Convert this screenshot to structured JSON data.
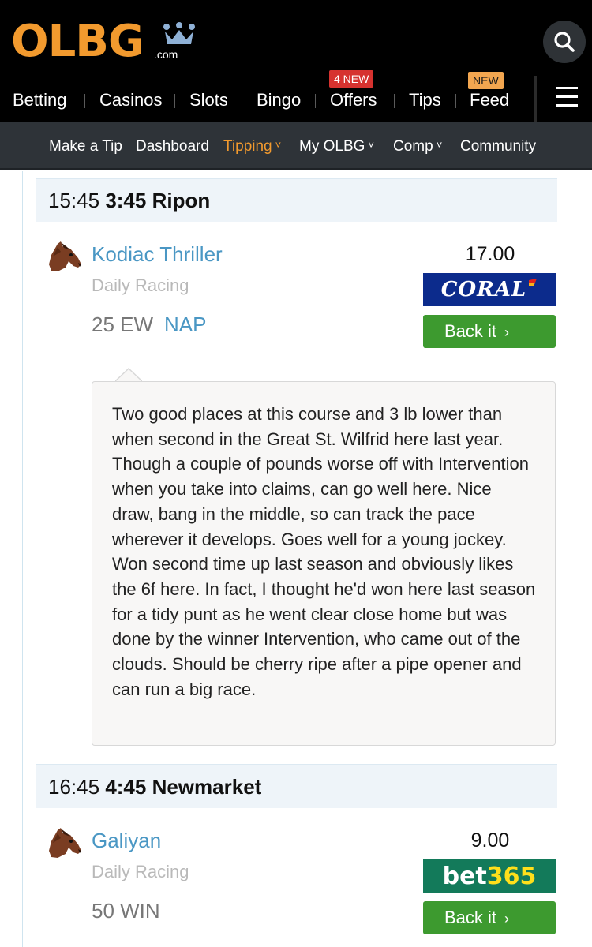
{
  "header": {
    "logo": {
      "text": "OLBG",
      "suffix": ".com"
    },
    "nav": [
      {
        "label": "Betting"
      },
      {
        "label": "Casinos"
      },
      {
        "label": "Slots"
      },
      {
        "label": "Bingo"
      },
      {
        "label": "Offers",
        "badge": "4 NEW"
      },
      {
        "label": "Tips"
      },
      {
        "label": "Feed",
        "badge": "NEW"
      }
    ],
    "icons": {
      "search": "search-icon",
      "menu": "hamburger-menu-icon",
      "crown": "crown-icon"
    },
    "colors": {
      "brand_orange": "#f29a2e",
      "badge_red": "#d6322f",
      "badge_gold": "#f2a650"
    }
  },
  "subnav": {
    "items": [
      {
        "label": "Make a Tip"
      },
      {
        "label": "Dashboard"
      },
      {
        "label": "Tipping",
        "dropdown": true,
        "active": true
      },
      {
        "label": "My OLBG",
        "dropdown": true
      },
      {
        "label": "Comp",
        "dropdown": true
      },
      {
        "label": "Community"
      }
    ],
    "chevron": "˅"
  },
  "races": [
    {
      "time_24": "15:45",
      "race": "3:45 Ripon",
      "horse": "Kodiac Thriller",
      "tip_type": "Daily Racing",
      "stake": "25 EW",
      "label": "NAP",
      "odds": "17.00",
      "bookmaker": "CORAL",
      "back_label": "Back it",
      "comment": "Two good places at this course and 3 lb lower than when second in the Great St. Wilfrid here last year. Though a couple of pounds worse off with Intervention when you take into claims, can go well here. Nice draw, bang in the middle, so can track the pace wherever it develops. Goes well for a young jockey. Won second time up last season and obviously likes the 6f here. In fact, I thought he'd won here last season for a tidy punt as he went clear close home but was done by the winner Intervention, who came out of the clouds. Should be cherry ripe after a pipe opener and can run a big race."
    },
    {
      "time_24": "16:45",
      "race": "4:45 Newmarket",
      "horse": "Galiyan",
      "tip_type": "Daily Racing",
      "stake": "50 WIN",
      "odds": "9.00",
      "bookmaker_a": "bet",
      "bookmaker_b": "365",
      "back_label": "Back it"
    }
  ],
  "glyphs": {
    "back_chevron": "›"
  }
}
